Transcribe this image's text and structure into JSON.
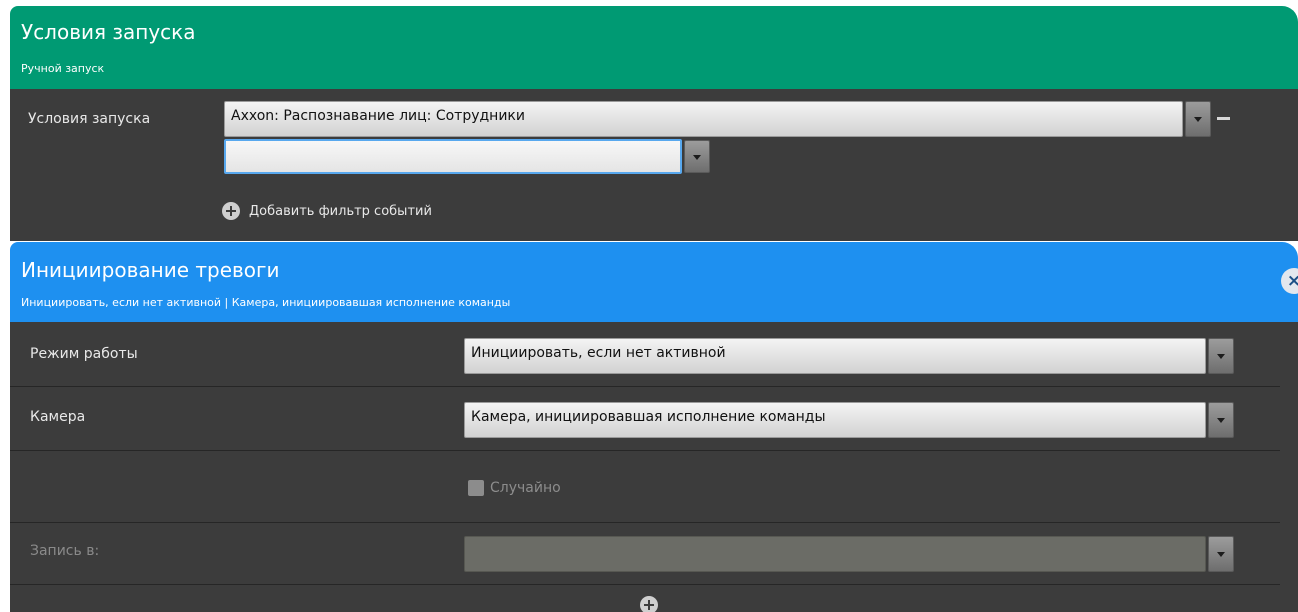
{
  "trigger": {
    "title": "Условия запуска",
    "subtitle": "Ручной запуск",
    "label": "Условия запуска",
    "selected": "Axxon: Распознавание лиц: Сотрудники",
    "filter_value": "",
    "add_filter_label": "Добавить фильтр событий",
    "color": "#009a73"
  },
  "alarm": {
    "title": "Инициирование тревоги",
    "subtitle": "Инициировать, если нет активной | Камера, инициировавшая исполнение команды",
    "color": "#1e90f0",
    "close_icon": "×",
    "mode": {
      "label": "Режим работы",
      "value": "Инициировать, если нет активной"
    },
    "camera": {
      "label": "Камера",
      "value": "Камера, инициировавшая исполнение команды"
    },
    "random": {
      "label": "Случайно",
      "checked": false
    },
    "record_to": {
      "label": "Запись в:",
      "value": ""
    }
  },
  "icons": {
    "dropdown": "chevron-down-icon",
    "remove": "minus-icon",
    "add": "plus-circle-icon",
    "close": "close-icon"
  }
}
